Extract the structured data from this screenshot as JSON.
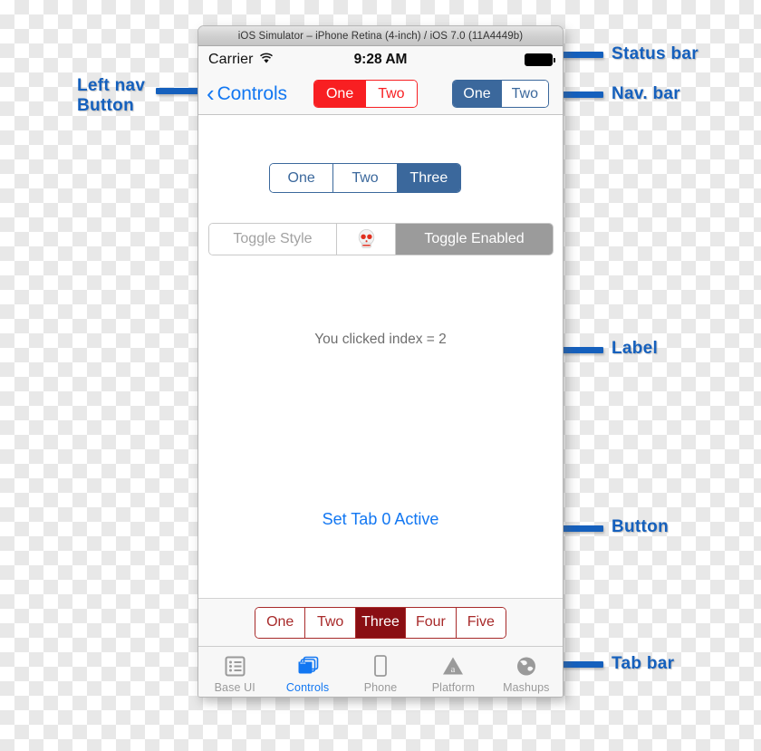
{
  "simulator": {
    "title": "iOS Simulator – iPhone Retina (4-inch) / iOS 7.0 (11A4449b)"
  },
  "status_bar": {
    "carrier": "Carrier",
    "wifi_icon": "wifi-icon",
    "time": "9:28 AM",
    "battery_icon": "battery-full-icon"
  },
  "nav_bar": {
    "back_chevron": "chevron-left-icon",
    "back_label": "Controls",
    "red_segments": [
      {
        "label": "One",
        "selected": true
      },
      {
        "label": "Two",
        "selected": false
      }
    ],
    "blue_segments": [
      {
        "label": "One",
        "selected": true
      },
      {
        "label": "Two",
        "selected": false
      }
    ]
  },
  "content": {
    "main_segments": [
      {
        "label": "One",
        "selected": false
      },
      {
        "label": "Two",
        "selected": false
      },
      {
        "label": "Three",
        "selected": true
      }
    ],
    "toggle_row": {
      "style_label": "Toggle Style",
      "skull_icon": "skull-icon",
      "enabled_label": "Toggle Enabled"
    },
    "clicked_label": "You clicked index = 2",
    "set_tab_button": "Set Tab 0 Active"
  },
  "bottom_segments": [
    {
      "label": "One",
      "selected": false
    },
    {
      "label": "Two",
      "selected": false
    },
    {
      "label": "Three",
      "selected": true
    },
    {
      "label": "Four",
      "selected": false
    },
    {
      "label": "Five",
      "selected": false
    }
  ],
  "tab_bar": [
    {
      "label": "Base UI",
      "icon": "list-icon",
      "selected": false
    },
    {
      "label": "Controls",
      "icon": "windows-icon",
      "selected": true
    },
    {
      "label": "Phone",
      "icon": "phone-icon",
      "selected": false
    },
    {
      "label": "Platform",
      "icon": "triangle-a-icon",
      "selected": false
    },
    {
      "label": "Mashups",
      "icon": "globe-icon",
      "selected": false
    }
  ],
  "annotations": {
    "left_nav_button": "Left nav\nButton",
    "status_bar": "Status bar",
    "nav_bar": "Nav. bar",
    "label": "Label",
    "button": "Button",
    "tab_bar": "Tab bar"
  },
  "colors": {
    "accent_blue": "#1277f2",
    "annotation_blue": "#1560bd",
    "steel_blue": "#3b689c",
    "bright_red": "#f81f22",
    "dark_red": "#8a0e13",
    "gray": "#9b9b9b"
  }
}
